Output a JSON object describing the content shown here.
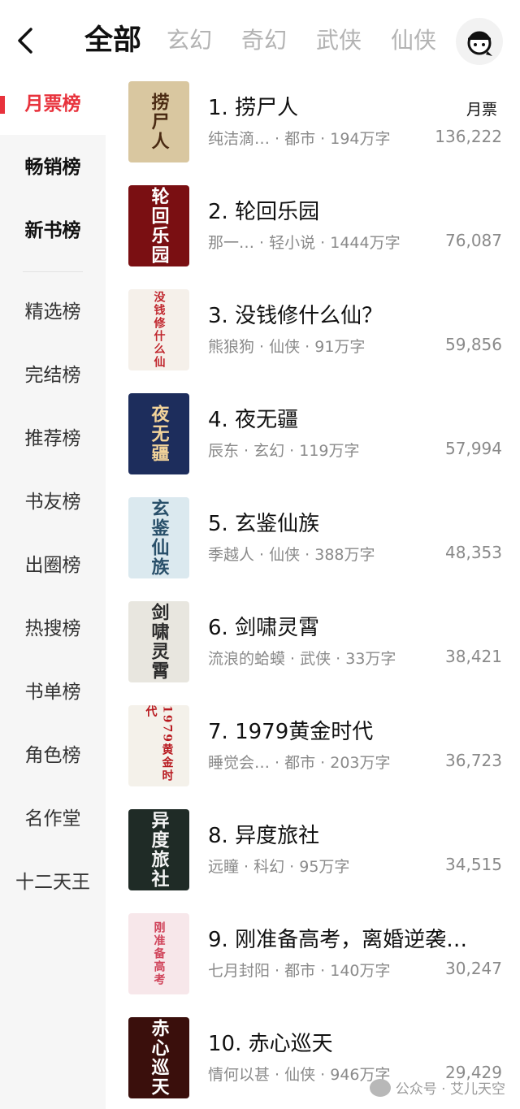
{
  "tabs": [
    {
      "label": "全部",
      "active": true
    },
    {
      "label": "玄幻",
      "active": false
    },
    {
      "label": "奇幻",
      "active": false
    },
    {
      "label": "武侠",
      "active": false
    },
    {
      "label": "仙侠",
      "active": false
    }
  ],
  "sidebar": {
    "items": [
      {
        "label": "月票榜"
      },
      {
        "label": "畅销榜"
      },
      {
        "label": "新书榜"
      },
      {
        "label": "精选榜"
      },
      {
        "label": "完结榜"
      },
      {
        "label": "推荐榜"
      },
      {
        "label": "书友榜"
      },
      {
        "label": "出圈榜"
      },
      {
        "label": "热搜榜"
      },
      {
        "label": "书单榜"
      },
      {
        "label": "角色榜"
      },
      {
        "label": "名作堂"
      },
      {
        "label": "十二天王"
      }
    ]
  },
  "rank_type": "月票",
  "books": [
    {
      "title": "1. 捞尸人",
      "meta": "纯洁滴… · 都市 · 194万字",
      "count": "136,222",
      "cover_text": "捞尸人",
      "cover_bg": "#d9c7a0",
      "cover_fg": "#4a2a12"
    },
    {
      "title": "2. 轮回乐园",
      "meta": "那一… · 轻小说 · 1444万字",
      "count": "76,087",
      "cover_text": "轮回乐园",
      "cover_bg": "#7a0f12",
      "cover_fg": "#ffffff"
    },
    {
      "title": "3. 没钱修什么仙？",
      "meta": "熊狼狗 · 仙侠 · 91万字",
      "count": "59,856",
      "cover_text": "没钱修什么仙",
      "cover_bg": "#f5f0ea",
      "cover_fg": "#c0262d"
    },
    {
      "title": "4. 夜无疆",
      "meta": "辰东 · 玄幻 · 119万字",
      "count": "57,994",
      "cover_text": "夜无疆",
      "cover_bg": "#1d2d5c",
      "cover_fg": "#f2d39a"
    },
    {
      "title": "5. 玄鉴仙族",
      "meta": "季越人 · 仙侠 · 388万字",
      "count": "48,353",
      "cover_text": "玄鉴仙族",
      "cover_bg": "#dbe9ef",
      "cover_fg": "#29506a"
    },
    {
      "title": "6. 剑啸灵霄",
      "meta": "流浪的蛤蟆 · 武侠 · 33万字",
      "count": "38,421",
      "cover_text": "剑啸灵霄",
      "cover_bg": "#e8e6df",
      "cover_fg": "#2b2b2b"
    },
    {
      "title": "7. 1979黄金时代",
      "meta": "睡觉会… · 都市 · 203万字",
      "count": "36,723",
      "cover_text": "1979黄金时代",
      "cover_bg": "#f4f1ea",
      "cover_fg": "#b8191f"
    },
    {
      "title": "8. 异度旅社",
      "meta": "远瞳 · 科幻 · 95万字",
      "count": "34,515",
      "cover_text": "异度旅社",
      "cover_bg": "#1f2b26",
      "cover_fg": "#f4f4f4"
    },
    {
      "title": "9. 刚准备高考，离婚逆袭…",
      "meta": "七月封阳 · 都市 · 140万字",
      "count": "30,247",
      "cover_text": "刚准备高考",
      "cover_bg": "#f7e7ea",
      "cover_fg": "#d0435a"
    },
    {
      "title": "10. 赤心巡天",
      "meta": "情何以甚 · 仙侠 · 946万字",
      "count": "29,429",
      "cover_text": "赤心巡天",
      "cover_bg": "#3a0f0c",
      "cover_fg": "#ffffff"
    }
  ],
  "watermark": "公众号 · 艾儿天空"
}
